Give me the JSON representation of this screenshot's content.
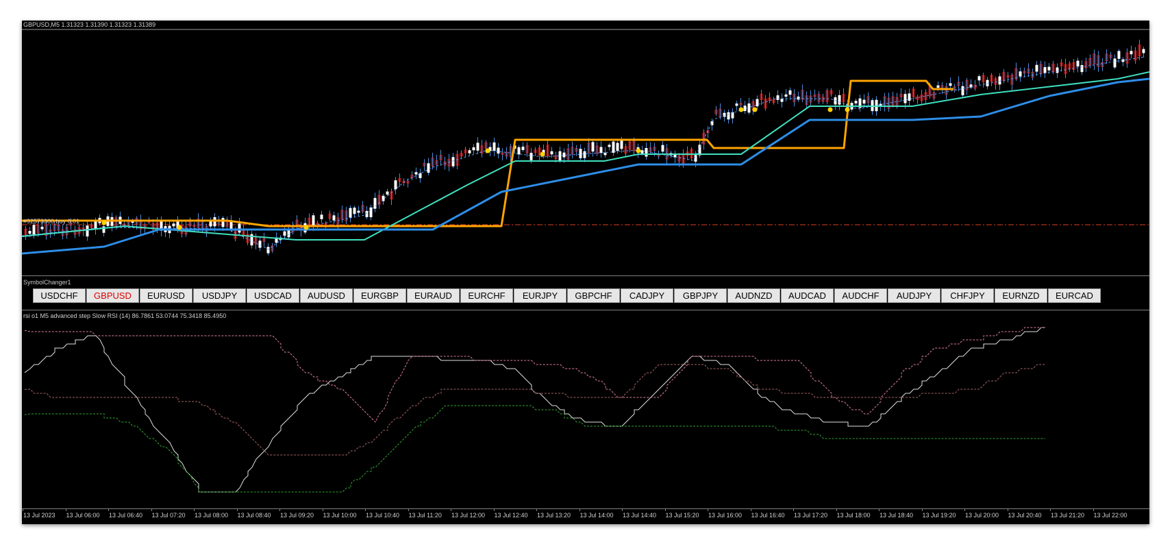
{
  "chart": {
    "header": "GBPUSD,M5  1.31323 1.31390 1.31323 1.31389",
    "order_label": "#92573300 buy 0.01"
  },
  "colors": {
    "background": "#000000",
    "bull_candle": "#ffffff",
    "bear_candle": "#e02020",
    "wick": "#4a8fe0",
    "orange_line": "#ffa500",
    "teal_line": "#40e0c0",
    "blue_line": "#2e8ee8",
    "order_line": "#e04020",
    "rsi_pink": "#e0809a",
    "rsi_green": "#2fa82f",
    "rsi_white": "#e0e0e0",
    "rsi_darkpink": "#a86464",
    "active_symbol": "#e00000"
  },
  "symbol_changer": {
    "title": "SymbolChanger1",
    "active": "GBPUSD",
    "buttons": [
      "USDCHF",
      "GBPUSD",
      "EURUSD",
      "USDJPY",
      "USDCAD",
      "AUDUSD",
      "EURGBP",
      "EURAUD",
      "EURCHF",
      "EURJPY",
      "GBPCHF",
      "CADJPY",
      "GBPJPY",
      "AUDNZD",
      "AUDCAD",
      "AUDCHF",
      "AUDJPY",
      "CHFJPY",
      "EURNZD",
      "EURCAD"
    ]
  },
  "rsi": {
    "header": "rsi o1 M5 advanced step Slow RSI (14) 86.7861 53.0744 75.3418 85.4950"
  },
  "time_axis": {
    "labels": [
      "13 Jul 2023",
      "13 Jul 06:00",
      "13 Jul 06:40",
      "13 Jul 07:20",
      "13 Jul 08:00",
      "13 Jul 08:40",
      "13 Jul 09:20",
      "13 Jul 10:00",
      "13 Jul 10:40",
      "13 Jul 11:20",
      "13 Jul 12:00",
      "13 Jul 12:40",
      "13 Jul 13:20",
      "13 Jul 14:00",
      "13 Jul 14:40",
      "13 Jul 15:20",
      "13 Jul 16:00",
      "13 Jul 16:40",
      "13 Jul 17:20",
      "13 Jul 18:00",
      "13 Jul 18:40",
      "13 Jul 19:20",
      "13 Jul 20:00",
      "13 Jul 20:40",
      "13 Jul 21:20",
      "13 Jul 22:00"
    ]
  },
  "chart_data": [
    {
      "type": "line",
      "title": "GBPUSD,M5",
      "description_values": {
        "open": 1.31323,
        "high": 1.3139,
        "low": 1.31323,
        "close": 1.31389
      },
      "series": [
        {
          "name": "",
          "role": "orange-step",
          "points": [
            [
              0,
              292
            ],
            [
              120,
              292
            ],
            [
              300,
              292
            ],
            [
              360,
              300
            ],
            [
              700,
              300
            ],
            [
              720,
              174
            ],
            [
              1000,
              174
            ],
            [
              1010,
              186
            ],
            [
              1200,
              186
            ],
            [
              1210,
              88
            ],
            [
              1320,
              88
            ],
            [
              1330,
              100
            ],
            [
              1360,
              100
            ]
          ]
        },
        {
          "name": "",
          "role": "teal",
          "points": [
            [
              0,
              315
            ],
            [
              150,
              300
            ],
            [
              400,
              320
            ],
            [
              500,
              320
            ],
            [
              650,
              240
            ],
            [
              720,
              205
            ],
            [
              850,
              205
            ],
            [
              900,
              195
            ],
            [
              1050,
              195
            ],
            [
              1150,
              125
            ],
            [
              1300,
              125
            ],
            [
              1400,
              108
            ],
            [
              1600,
              85
            ],
            [
              1646,
              75
            ]
          ]
        },
        {
          "name": "",
          "role": "blue-step",
          "points": [
            [
              0,
              340
            ],
            [
              120,
              330
            ],
            [
              200,
              305
            ],
            [
              600,
              305
            ],
            [
              700,
              250
            ],
            [
              800,
              230
            ],
            [
              900,
              210
            ],
            [
              1050,
              210
            ],
            [
              1150,
              145
            ],
            [
              1300,
              145
            ],
            [
              1400,
              140
            ],
            [
              1500,
              110
            ],
            [
              1600,
              90
            ],
            [
              1646,
              85
            ]
          ]
        }
      ]
    },
    {
      "type": "line",
      "title": "rsi o1 M5 advanced step Slow RSI (14)",
      "series": [
        {
          "name": "",
          "role": "white",
          "values": [
            70,
            85,
            93,
            60,
            30,
            0,
            0,
            30,
            55,
            68,
            80,
            80,
            78,
            78,
            72,
            50,
            40,
            38,
            60,
            80,
            75,
            55,
            45,
            40,
            38,
            55,
            70,
            85,
            90,
            97
          ]
        },
        {
          "name": "",
          "role": "pink",
          "values": [
            95,
            95,
            93,
            93,
            93,
            93,
            93,
            93,
            70,
            60,
            40,
            80,
            80,
            78,
            78,
            75,
            70,
            55,
            55,
            80,
            80,
            78,
            78,
            55,
            45,
            70,
            85,
            90,
            95,
            97
          ]
        },
        {
          "name": "",
          "role": "green",
          "values": [
            45,
            45,
            45,
            40,
            25,
            0,
            0,
            0,
            0,
            0,
            15,
            35,
            50,
            50,
            50,
            48,
            38,
            38,
            38,
            38,
            38,
            38,
            35,
            30,
            30,
            30,
            30,
            30,
            30,
            32
          ]
        },
        {
          "name": "",
          "role": "darkpink",
          "values": [
            60,
            55,
            55,
            55,
            55,
            52,
            40,
            20,
            20,
            20,
            30,
            50,
            60,
            60,
            60,
            58,
            55,
            55,
            75,
            75,
            72,
            60,
            58,
            55,
            55,
            55,
            58,
            60,
            70,
            75
          ]
        }
      ]
    }
  ]
}
